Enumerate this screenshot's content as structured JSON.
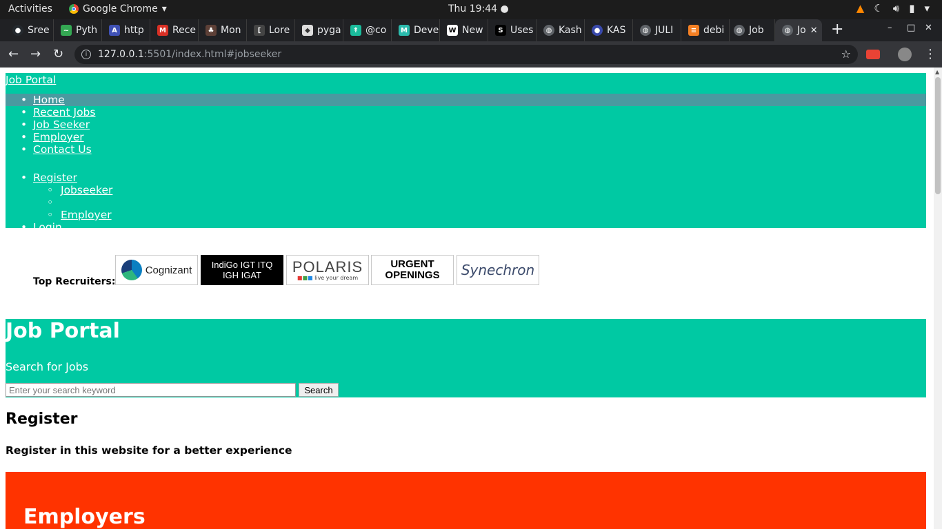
{
  "system": {
    "activities": "Activities",
    "app_name": "Google Chrome",
    "clock": "Thu 19:44 ●"
  },
  "tabs": [
    {
      "label": "Sree",
      "icon": "github-icon",
      "color": "#24292e"
    },
    {
      "label": "Pyth",
      "icon": "chart-icon",
      "color": "#34a853"
    },
    {
      "label": "http",
      "icon": "angular-icon",
      "color": "#3f51b5"
    },
    {
      "label": "Rece",
      "icon": "gmail-icon",
      "color": "#d93025"
    },
    {
      "label": "Mon",
      "icon": "palm-icon",
      "color": "#5d4037"
    },
    {
      "label": "Lore",
      "icon": "bracket-icon",
      "color": "#444444"
    },
    {
      "label": "pyga",
      "icon": "cube-icon",
      "color": "#dddddd"
    },
    {
      "label": "@co",
      "icon": "arrows-icon",
      "color": "#1abc9c"
    },
    {
      "label": "Deve",
      "icon": "m-icon",
      "color": "#2bbbad"
    },
    {
      "label": "New",
      "icon": "wikipedia-icon",
      "color": "#ffffff"
    },
    {
      "label": "Uses",
      "icon": "s-icon",
      "color": "#000000"
    },
    {
      "label": "Kash",
      "icon": "globe-icon",
      "color": "#5f6368"
    },
    {
      "label": "KAS",
      "icon": "earth-icon",
      "color": "#3949ab"
    },
    {
      "label": "JULI",
      "icon": "globe-icon",
      "color": "#5f6368"
    },
    {
      "label": "debi",
      "icon": "stackoverflow-icon",
      "color": "#f48024"
    },
    {
      "label": "Job",
      "icon": "globe-icon",
      "color": "#5f6368"
    },
    {
      "label": "Jo",
      "icon": "globe-icon",
      "color": "#5f6368",
      "active": true
    }
  ],
  "address_bar": {
    "host": "127.0.0.1",
    "rest": ":5501/index.html#jobseeker"
  },
  "page": {
    "brand": "Job Portal",
    "nav_main": [
      "Home",
      "Recent Jobs",
      "Job Seeker",
      "Employer",
      "Contact Us"
    ],
    "nav_register": "Register",
    "nav_register_sub": [
      "Jobseeker",
      "",
      "Employer"
    ],
    "nav_login": "Login",
    "recruiters_label": "Top Recruiters:",
    "recruiters": [
      {
        "name": "Cognizant"
      },
      {
        "line1": "IndiGo  IGT  ITQ",
        "line2": "IGH IGAT"
      },
      {
        "name": "POLARIS",
        "tagline": "live your dream"
      },
      {
        "line1": "URGENT",
        "line2": "OPENINGS"
      },
      {
        "name": "Synechron"
      }
    ],
    "hero": {
      "title": "Job Portal",
      "subtitle": "Search for Jobs",
      "search_placeholder": "Enter your search keyword",
      "search_button": "Search"
    },
    "register_title": "Register",
    "register_desc": "Register in this website for a better experience",
    "employers_title": "Employers"
  },
  "colors": {
    "teal": "#00c9a3",
    "highlight": "#4a9aa0",
    "employers_bg": "#ff3300"
  }
}
